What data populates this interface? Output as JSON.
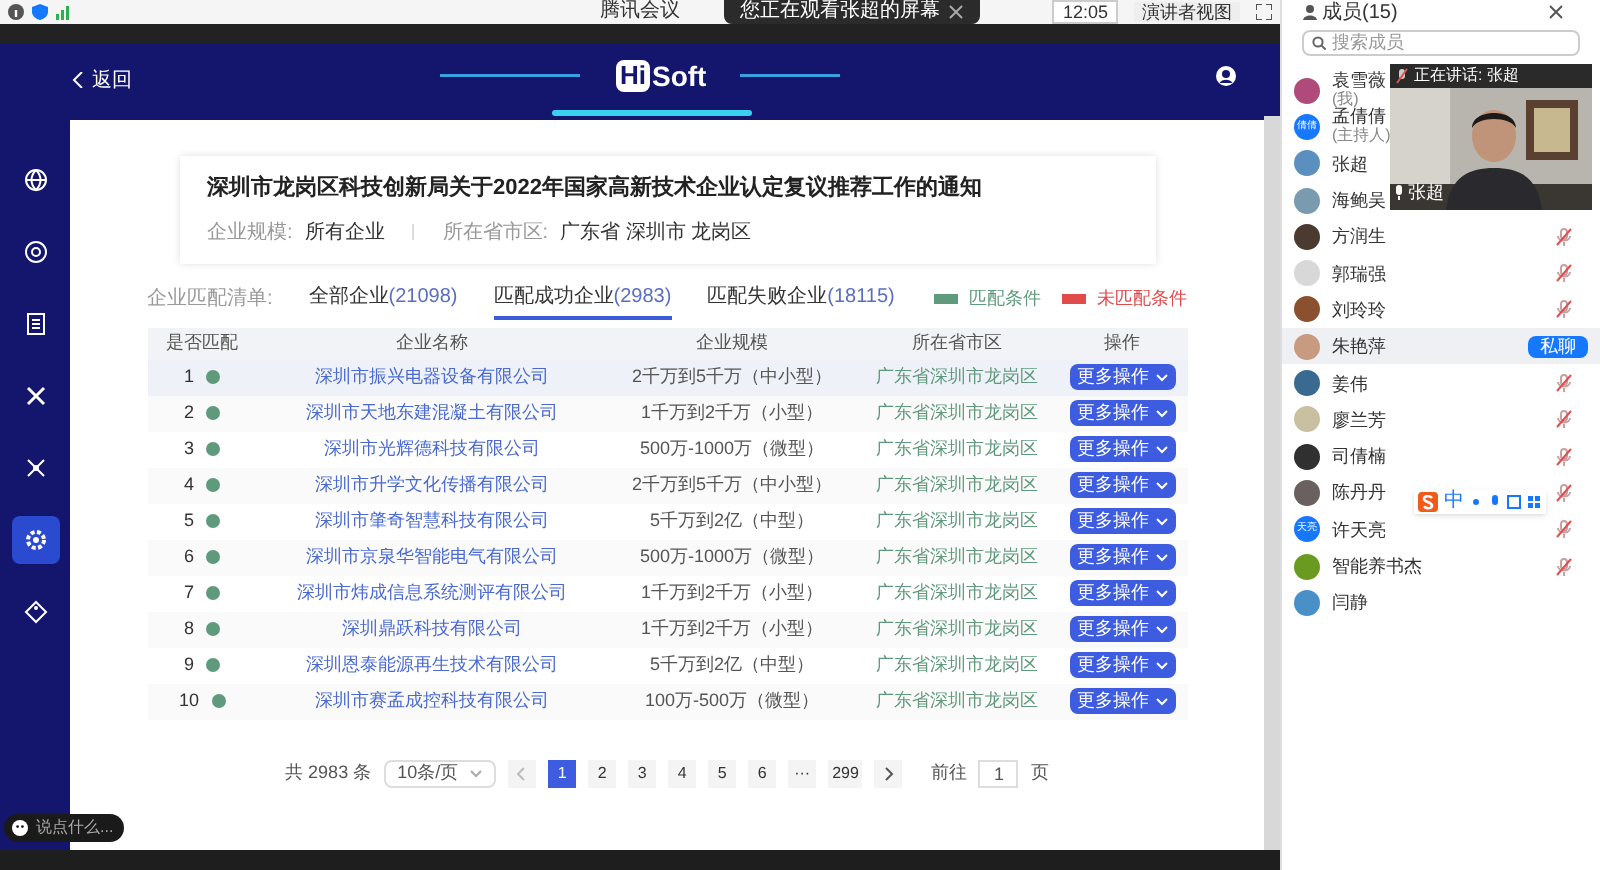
{
  "window": {
    "title": "腾讯会议"
  },
  "toolbar": {
    "sharing_banner": "您正在观看张超的屏幕",
    "time": "12:05",
    "view_button": "演讲者视图"
  },
  "shared_screen": {
    "back_link": "返回",
    "logo": {
      "hi": "Hi",
      "soft": "Soft"
    },
    "sidebar_items": [
      {
        "selected": false
      },
      {
        "selected": false
      },
      {
        "selected": false
      },
      {
        "selected": false
      },
      {
        "selected": false
      },
      {
        "selected": true
      },
      {
        "selected": false
      }
    ],
    "notice": {
      "title": "深圳市龙岗区科技创新局关于2022年国家高新技术企业认定复议推荐工作的通知",
      "fields": [
        {
          "label": "企业规模:",
          "value": "所有企业"
        },
        {
          "label": "所在省市区:",
          "value": "广东省 深圳市 龙岗区"
        }
      ]
    },
    "tabs_label": "企业匹配清单:",
    "tabs": [
      {
        "label": "全部企业",
        "count": "(21098)",
        "selected": false
      },
      {
        "label": "匹配成功企业",
        "count": "(2983)",
        "selected": true
      },
      {
        "label": "匹配失败企业",
        "count": "(18115)",
        "selected": false
      }
    ],
    "legend": [
      {
        "label": "匹配条件",
        "color": "#5f9a7c"
      },
      {
        "label": "未匹配条件",
        "color": "#e04b4b"
      }
    ],
    "table": {
      "columns": [
        "是否匹配",
        "企业名称",
        "企业规模",
        "所在省市区",
        "操作"
      ],
      "rows": [
        {
          "index": "1",
          "matched": true,
          "name": "深圳市振兴电器设备有限公司",
          "scale": "2千万到5千万（中小型）",
          "region": "广东省深圳市龙岗区",
          "action": "更多操作",
          "selected": true
        },
        {
          "index": "2",
          "matched": true,
          "name": "深圳市天地东建混凝土有限公司",
          "scale": "1千万到2千万（小型）",
          "region": "广东省深圳市龙岗区",
          "action": "更多操作",
          "selected": false
        },
        {
          "index": "3",
          "matched": true,
          "name": "深圳市光辉德科技有限公司",
          "scale": "500万-1000万（微型）",
          "region": "广东省深圳市龙岗区",
          "action": "更多操作",
          "selected": false
        },
        {
          "index": "4",
          "matched": true,
          "name": "深圳市升学文化传播有限公司",
          "scale": "2千万到5千万（中小型）",
          "region": "广东省深圳市龙岗区",
          "action": "更多操作",
          "selected": false
        },
        {
          "index": "5",
          "matched": true,
          "name": "深圳市肇奇智慧科技有限公司",
          "scale": "5千万到2亿（中型）",
          "region": "广东省深圳市龙岗区",
          "action": "更多操作",
          "selected": false
        },
        {
          "index": "6",
          "matched": true,
          "name": "深圳市京泉华智能电气有限公司",
          "scale": "500万-1000万（微型）",
          "region": "广东省深圳市龙岗区",
          "action": "更多操作",
          "selected": false
        },
        {
          "index": "7",
          "matched": true,
          "name": "深圳市炜成信息系统测评有限公司",
          "scale": "1千万到2千万（小型）",
          "region": "广东省深圳市龙岗区",
          "action": "更多操作",
          "selected": false
        },
        {
          "index": "8",
          "matched": true,
          "name": "深圳鼎跃科技有限公司",
          "scale": "1千万到2千万（小型）",
          "region": "广东省深圳市龙岗区",
          "action": "更多操作",
          "selected": false
        },
        {
          "index": "9",
          "matched": true,
          "name": "深圳恩泰能源再生技术有限公司",
          "scale": "5千万到2亿（中型）",
          "region": "广东省深圳市龙岗区",
          "action": "更多操作",
          "selected": false
        },
        {
          "index": "10",
          "matched": true,
          "name": "深圳市赛孟成控科技有限公司",
          "scale": "100万-500万（微型）",
          "region": "广东省深圳市龙岗区",
          "action": "更多操作",
          "selected": false
        }
      ]
    },
    "pagination": {
      "total": "共 2983 条",
      "page_size": "10条/页",
      "pages": [
        {
          "label": "1",
          "selected": true
        },
        {
          "label": "2",
          "selected": false
        },
        {
          "label": "3",
          "selected": false
        },
        {
          "label": "4",
          "selected": false
        },
        {
          "label": "5",
          "selected": false
        },
        {
          "label": "6",
          "selected": false
        },
        {
          "label": "···",
          "selected": false
        },
        {
          "label": "299",
          "selected": false
        }
      ],
      "goto_label": "前往",
      "goto_value": "1",
      "goto_suffix": "页"
    },
    "chat_input": {
      "placeholder": "说点什么..."
    }
  },
  "members_panel": {
    "title": "成员(15)",
    "search_placeholder": "搜索成员",
    "members": [
      {
        "name": "袁雪薇",
        "role": "(我)",
        "color": "#b04a7a",
        "hovered": false
      },
      {
        "name": "孟倩倩",
        "role": "(主持人)",
        "color": "#1677ff",
        "avatar_text": "倩倩",
        "hovered": false
      },
      {
        "name": "张超",
        "color": "#5a8fc0",
        "hovered": false
      },
      {
        "name": "海鲍吴",
        "color": "#7a9ab0",
        "hovered": false
      },
      {
        "name": "方润生",
        "color": "#4a3a30",
        "muted": true,
        "hovered": false
      },
      {
        "name": "郭瑞强",
        "color": "#d8d8d8",
        "muted": true,
        "hovered": false
      },
      {
        "name": "刘玲玲",
        "color": "#8a5030",
        "muted": true,
        "hovered": false
      },
      {
        "name": "朱艳萍",
        "color": "#c89a80",
        "muted": false,
        "hovered": true,
        "action": "私聊"
      },
      {
        "name": "姜伟",
        "color": "#3a6a90",
        "muted": true,
        "hovered": false
      },
      {
        "name": "廖兰芳",
        "color": "#c8c0a0",
        "muted": true,
        "hovered": false
      },
      {
        "name": "司倩楠",
        "color": "#303030",
        "muted": true,
        "hovered": false
      },
      {
        "name": "陈丹丹",
        "color": "#6a6060",
        "muted": true,
        "hovered": false
      },
      {
        "name": "许天亮",
        "color": "#1677ff",
        "avatar_text": "天亮",
        "muted": true,
        "hovered": false
      },
      {
        "name": "智能养书杰",
        "color": "#6a9a20",
        "muted": true,
        "hovered": false
      },
      {
        "name": "闫静",
        "color": "#4a90c8",
        "muted": false,
        "hovered": false
      }
    ]
  },
  "speaker_video": {
    "caption": "正在讲话: 张超",
    "name": "张超"
  },
  "ime_toolbar": {
    "mode": "中"
  }
}
